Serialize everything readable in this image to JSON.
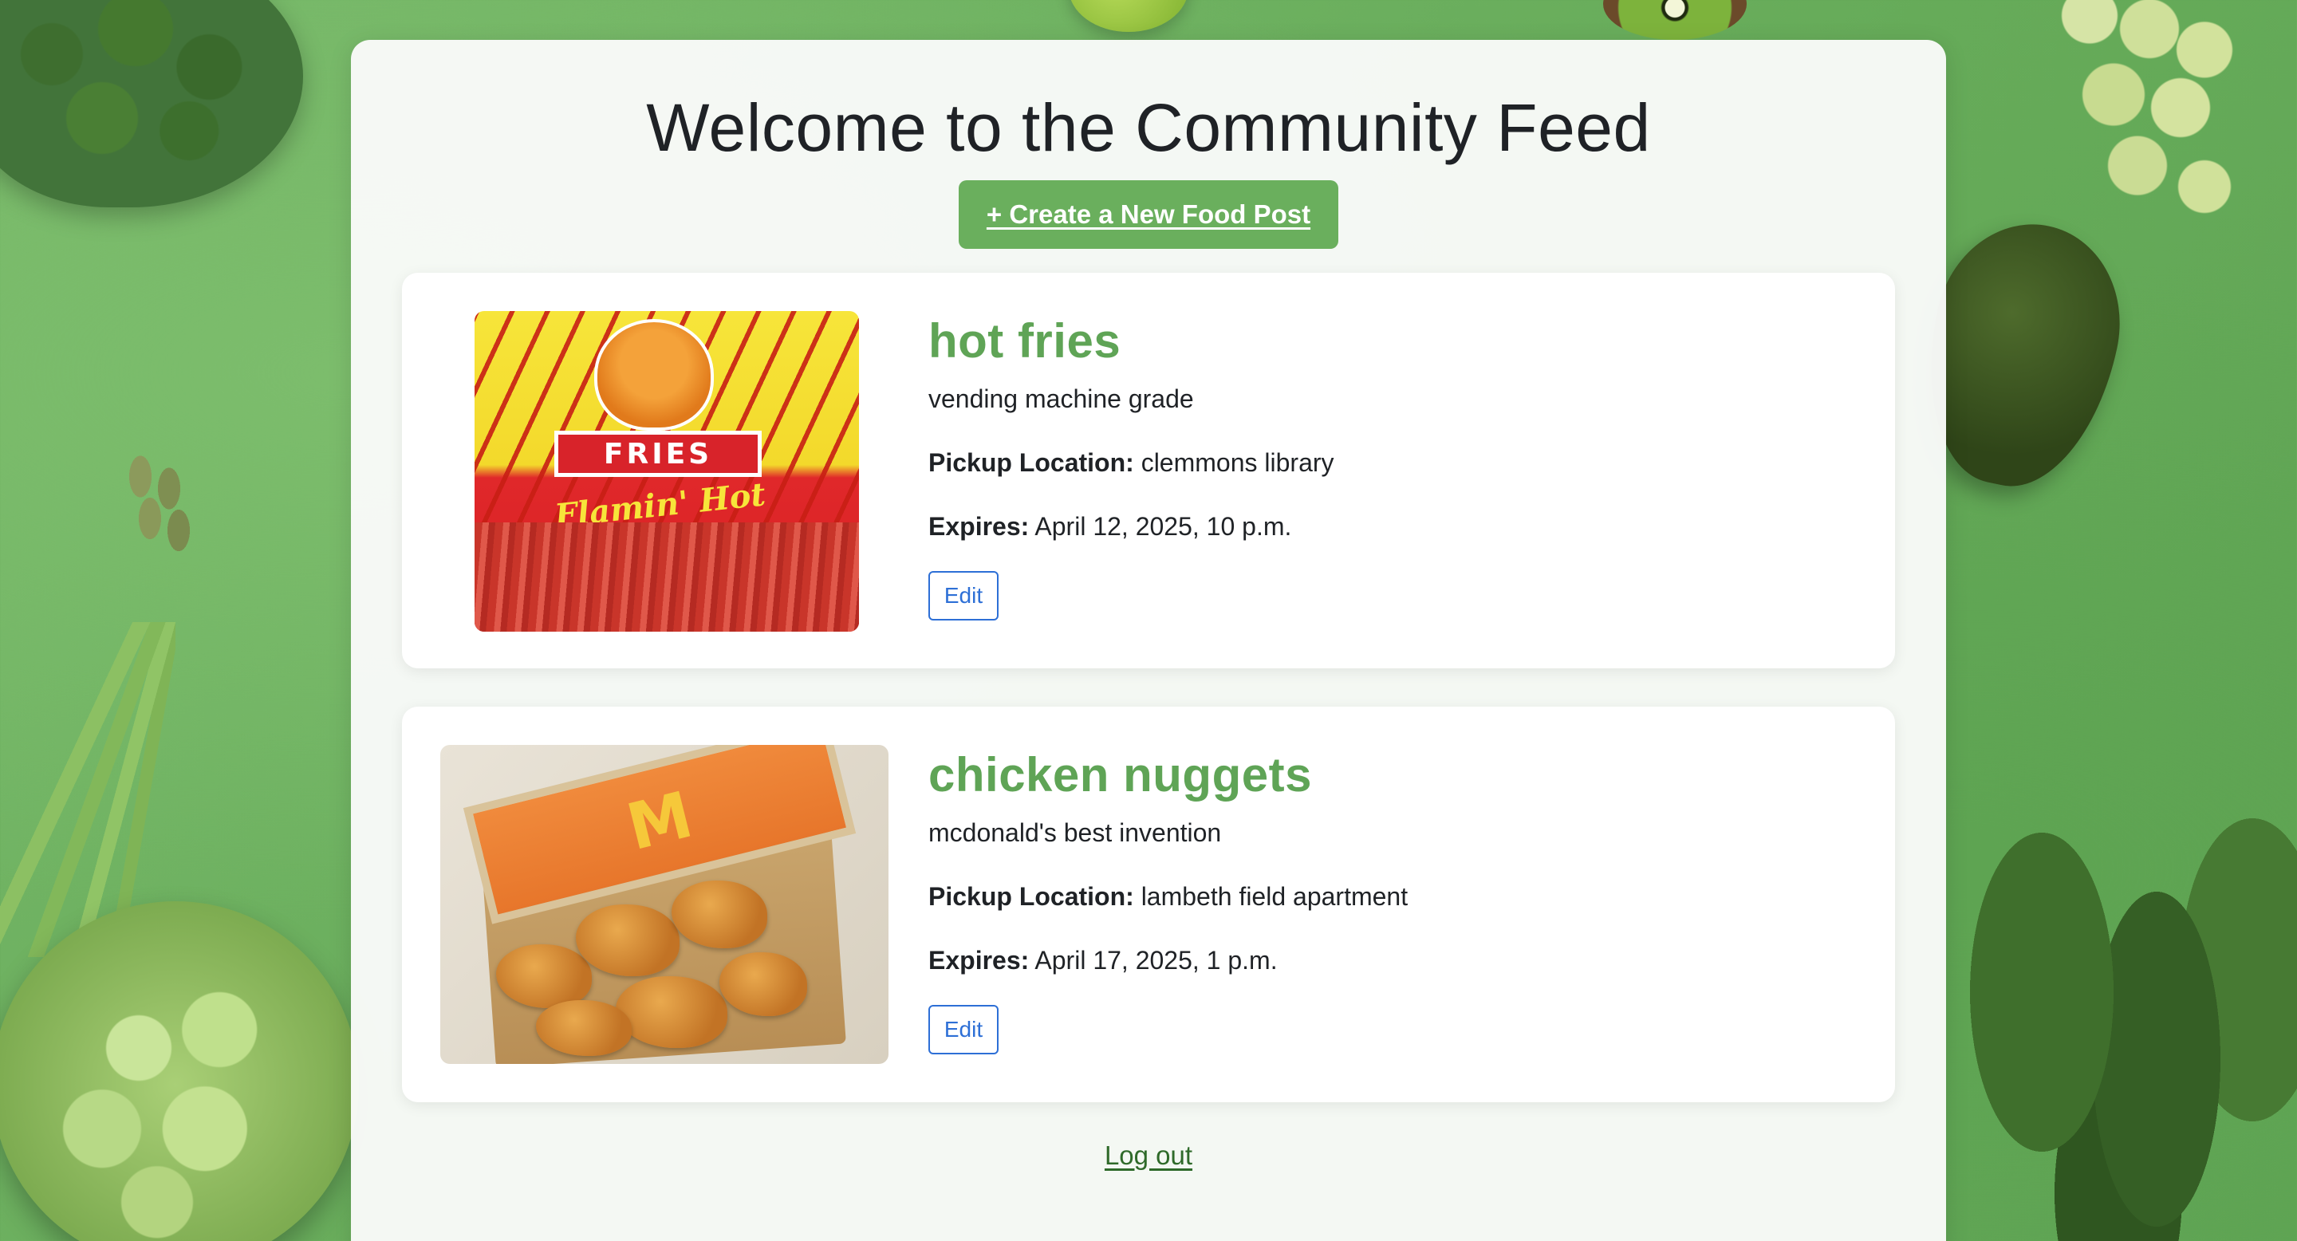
{
  "page": {
    "title": "Welcome to the Community Feed",
    "create_button": "+ Create a New Food Post",
    "logout": "Log out"
  },
  "posts": [
    {
      "title": "hot fries",
      "description": "vending machine grade",
      "pickup_label": "Pickup Location:",
      "pickup_value": "clemmons library",
      "expires_label": "Expires:",
      "expires_value": "April 12, 2025, 10 p.m.",
      "edit_label": "Edit",
      "image_text": {
        "brand_label": "FRIES",
        "flavor_script": "Flamin' Hot"
      }
    },
    {
      "title": "chicken nuggets",
      "description": "mcdonald's best invention",
      "pickup_label": "Pickup Location:",
      "pickup_value": "lambeth field apartment",
      "expires_label": "Expires:",
      "expires_value": "April 17, 2025, 1 p.m.",
      "edit_label": "Edit",
      "image_text": {
        "logo": "M"
      }
    }
  ],
  "colors": {
    "accent_green": "#6aaf5d",
    "title_green": "#5fa456",
    "edit_blue": "#2d6fd6",
    "logout_green": "#2f6a2a"
  }
}
